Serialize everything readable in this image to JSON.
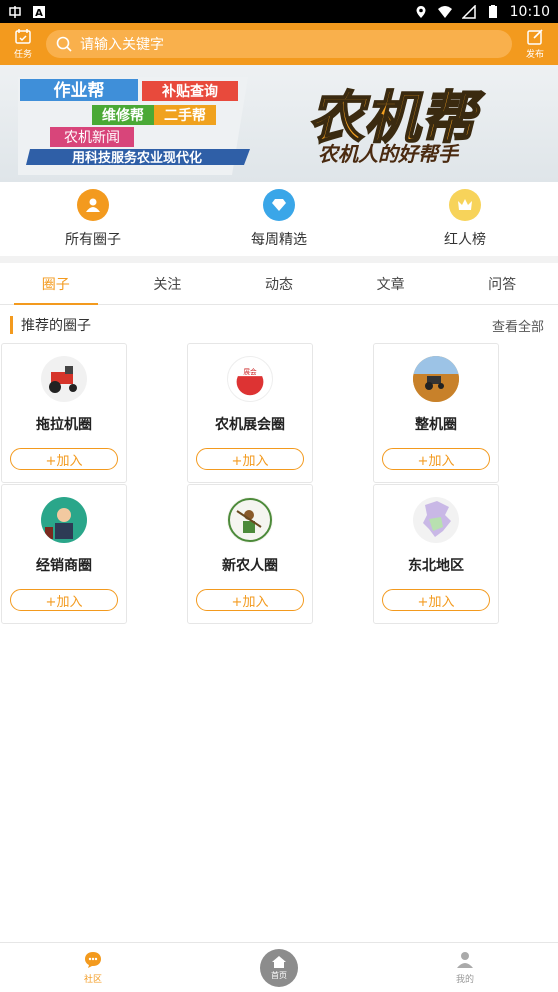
{
  "status_bar": {
    "time": "10:10"
  },
  "header": {
    "task_label": "任务",
    "publish_label": "发布",
    "search_placeholder": "请输入关键字"
  },
  "banner": {
    "tags": [
      "作业帮",
      "补贴查询",
      "维修帮",
      "二手帮",
      "农机新闻"
    ],
    "slogan": "用科技服务农业现代化",
    "brand": "农机帮",
    "brand_sub": "农机人的好帮手"
  },
  "categories": [
    {
      "label": "所有圈子",
      "icon": "group-icon",
      "color": "#f39a1e"
    },
    {
      "label": "每周精选",
      "icon": "diamond-icon",
      "color": "#3aa6e8"
    },
    {
      "label": "红人榜",
      "icon": "crown-icon",
      "color": "#f7c531"
    }
  ],
  "tabs": [
    "圈子",
    "关注",
    "动态",
    "文章",
    "问答"
  ],
  "section": {
    "title": "推荐的圈子",
    "more": "查看全部"
  },
  "circles": [
    {
      "name": "拖拉机圈",
      "join": "+加入",
      "icon": "tractor-icon"
    },
    {
      "name": "农机展会圈",
      "join": "+加入",
      "icon": "expo-badge-icon"
    },
    {
      "name": "整机圈",
      "join": "+加入",
      "icon": "farm-machine-icon"
    },
    {
      "name": "经销商圈",
      "join": "+加入",
      "icon": "dealer-icon"
    },
    {
      "name": "新农人圈",
      "join": "+加入",
      "icon": "farmer-icon"
    },
    {
      "name": "东北地区",
      "join": "+加入",
      "icon": "map-region-icon"
    }
  ],
  "bottom_nav": {
    "community": "社区",
    "home": "首页",
    "mine": "我的"
  },
  "colors": {
    "accent": "#f39a1e",
    "header_bg": "#f39a1e"
  }
}
